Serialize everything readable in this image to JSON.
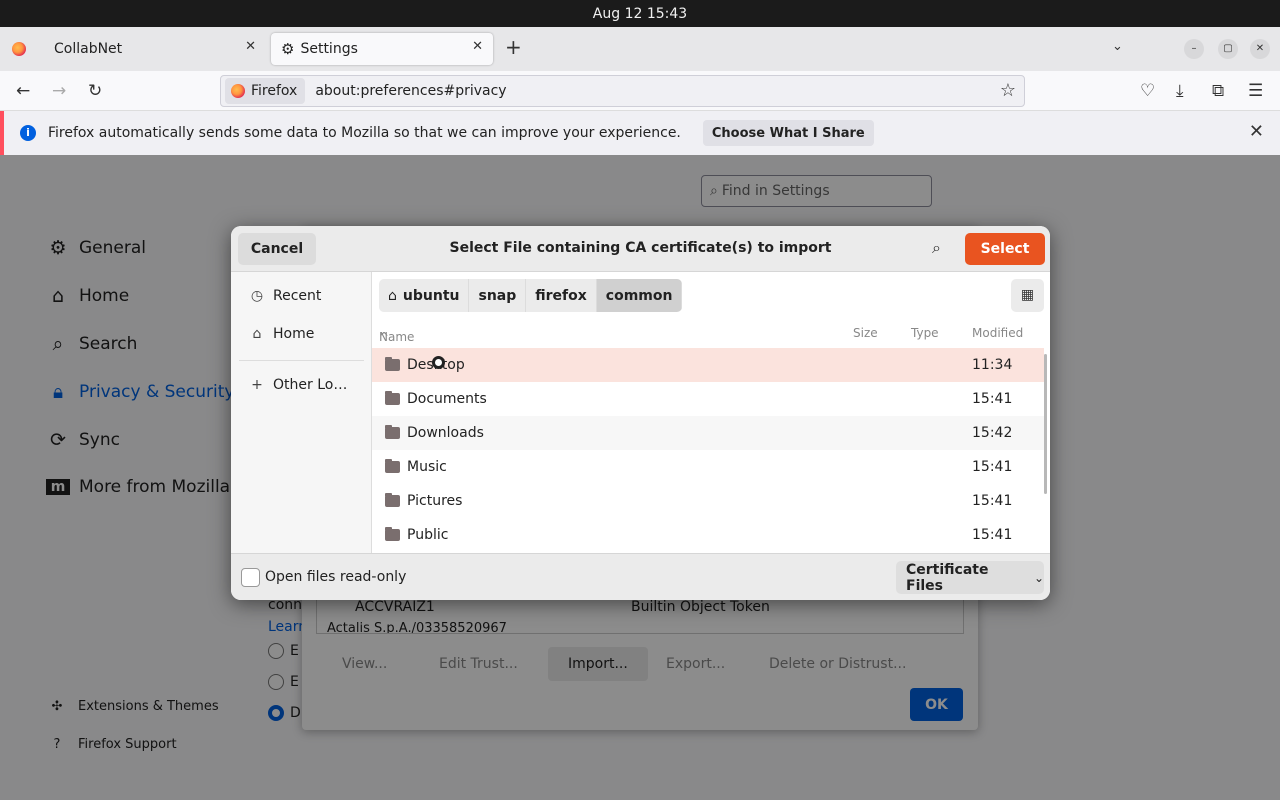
{
  "system": {
    "clock": "Aug 12  15:43"
  },
  "tabs": [
    {
      "label": "CollabNet"
    },
    {
      "label": "Settings"
    }
  ],
  "navbar": {
    "identity_label": "Firefox",
    "url": "about:preferences#privacy"
  },
  "notification": {
    "text": "Firefox automatically sends some data to Mozilla so that we can improve your experience.",
    "button": "Choose What I Share"
  },
  "settings": {
    "find_placeholder": "Find in Settings",
    "sidebar": [
      {
        "label": "General",
        "icon": "gear-icon"
      },
      {
        "label": "Home",
        "icon": "home-icon"
      },
      {
        "label": "Search",
        "icon": "search-icon"
      },
      {
        "label": "Privacy & Security",
        "icon": "lock-icon"
      },
      {
        "label": "Sync",
        "icon": "sync-icon"
      },
      {
        "label": "More from Mozilla",
        "icon": "mozilla-icon"
      }
    ],
    "footer_links": [
      {
        "label": "Extensions & Themes",
        "icon": "puzzle-icon"
      },
      {
        "label": "Firefox Support",
        "icon": "help-icon"
      }
    ],
    "partial": {
      "conn": "conn",
      "learn": "Learn",
      "e1": "E",
      "e2": "E",
      "d": "D"
    }
  },
  "cert_manager": {
    "row_name": "ACCVRAIZ1",
    "row_token": "Builtin Object Token",
    "row_next": "Actalis S.p.A./03358520967",
    "buttons": {
      "view": "View...",
      "edit_trust": "Edit Trust...",
      "import": "Import...",
      "export": "Export...",
      "delete": "Delete or Distrust..."
    },
    "ok": "OK"
  },
  "file_chooser": {
    "title": "Select File containing CA certificate(s) to import",
    "cancel": "Cancel",
    "select": "Select",
    "places": [
      {
        "label": "Recent",
        "icon": "clock-icon"
      },
      {
        "label": "Home",
        "icon": "home-icon"
      },
      {
        "label": "Other Lo…",
        "icon": "plus-icon"
      }
    ],
    "breadcrumbs": [
      "ubuntu",
      "snap",
      "firefox",
      "common"
    ],
    "columns": {
      "name": "Name",
      "size": "Size",
      "type": "Type",
      "modified": "Modified"
    },
    "files": [
      {
        "name": "Desktop",
        "modified": "11:34"
      },
      {
        "name": "Documents",
        "modified": "15:41"
      },
      {
        "name": "Downloads",
        "modified": "15:42"
      },
      {
        "name": "Music",
        "modified": "15:41"
      },
      {
        "name": "Pictures",
        "modified": "15:41"
      },
      {
        "name": "Public",
        "modified": "15:41"
      }
    ],
    "readonly_label": "Open files read-only",
    "filter": "Certificate Files"
  },
  "colors": {
    "accent_orange": "#e95420",
    "firefox_blue": "#0061e0",
    "selected_row": "#fbe3dd"
  }
}
